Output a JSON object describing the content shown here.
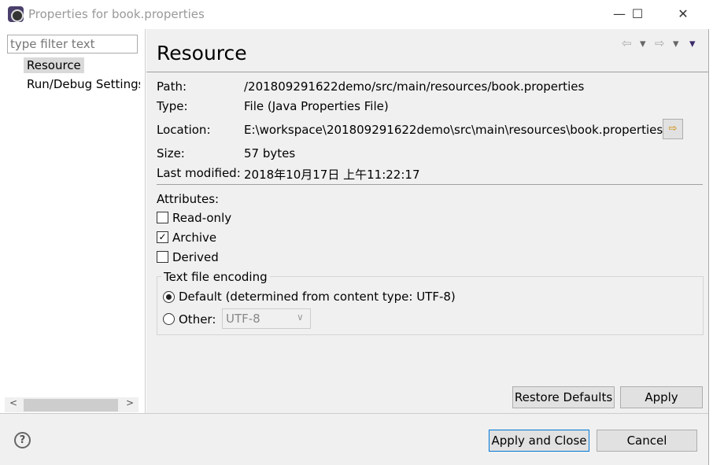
{
  "window": {
    "title": "Properties for book.properties",
    "minimize": "—",
    "maximize": "☐",
    "close": "✕"
  },
  "sidebar": {
    "filter_placeholder": "type filter text",
    "items": [
      {
        "label": "Resource",
        "selected": true
      },
      {
        "label": "Run/Debug Settings"
      }
    ]
  },
  "page": {
    "title": "Resource",
    "nav": {
      "back": "⇦",
      "back_menu": "▾",
      "forward": "⇨",
      "forward_menu": "▾",
      "view_menu": "▾"
    },
    "info": [
      {
        "label": "Path:",
        "value": "/201809291622demo/src/main/resources/book.properties"
      },
      {
        "label": "Type:",
        "value": "File  (Java Properties File)"
      },
      {
        "label": "Location:",
        "value": "E:\\workspace\\201809291622demo\\src\\main\\resources\\book.properties"
      },
      {
        "label": "Size:",
        "value": "57  bytes"
      },
      {
        "label": "Last modified:",
        "value": "2018年10月17日 上午11:22:17"
      }
    ],
    "attributes_label": "Attributes:",
    "attributes": [
      {
        "label": "Read-only",
        "checked": false
      },
      {
        "label": "Archive",
        "checked": true
      },
      {
        "label": "Derived",
        "checked": false
      }
    ],
    "encoding": {
      "group_title": "Text file encoding",
      "default_label": "Default (determined from content type: UTF-8)",
      "other_label": "Other:",
      "other_value": "UTF-8",
      "selected": "default"
    },
    "restore_defaults": "Restore Defaults",
    "apply": "Apply"
  },
  "footer": {
    "help": "?",
    "apply_close": "Apply and Close",
    "cancel": "Cancel"
  }
}
